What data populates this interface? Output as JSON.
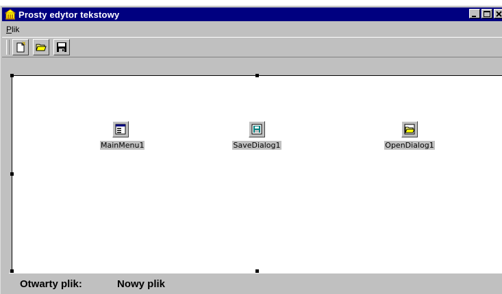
{
  "window": {
    "title": "Prosty edytor tekstowy"
  },
  "menu": {
    "items": [
      {
        "label": "Plik",
        "accel": "P",
        "rest": "lik"
      }
    ]
  },
  "toolbar": {
    "buttons": [
      "new-file",
      "open-file",
      "save-file"
    ]
  },
  "components": [
    {
      "label": "MainMenu1",
      "icon": "main-menu-icon"
    },
    {
      "label": "SaveDialog1",
      "icon": "save-dialog-icon"
    },
    {
      "label": "OpenDialog1",
      "icon": "open-dialog-icon"
    }
  ],
  "status": {
    "label": "Otwarty plik:",
    "value": "Nowy plik"
  },
  "colors": {
    "titlebar": "#000080",
    "face": "#c0c0c0",
    "canvas": "#ffffff"
  }
}
